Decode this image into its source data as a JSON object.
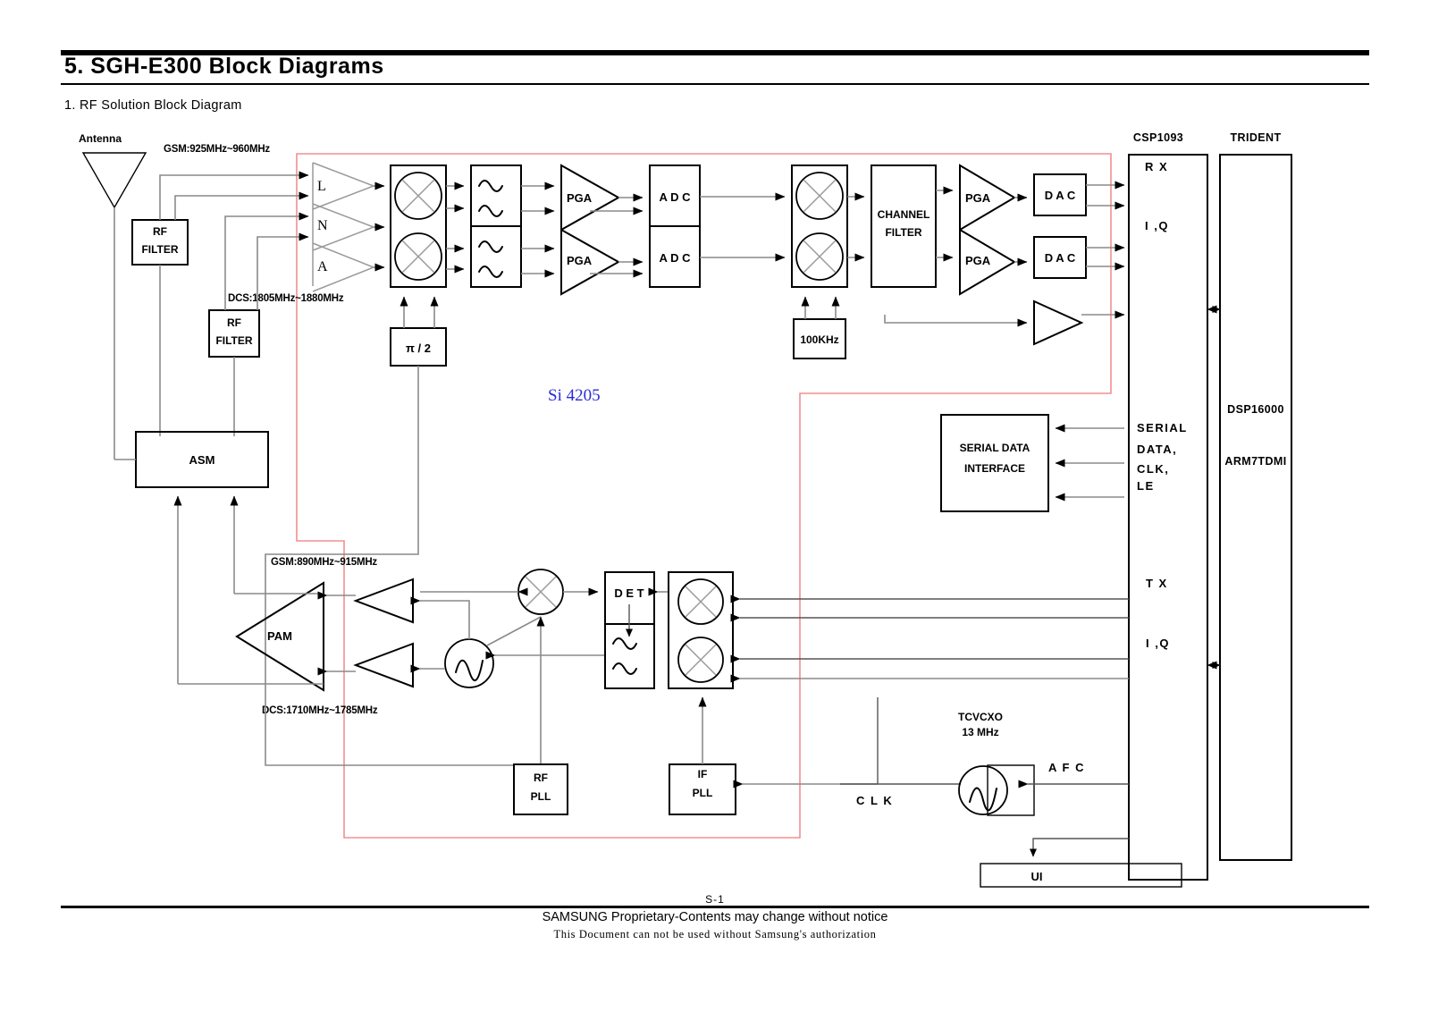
{
  "document": {
    "title": "5. SGH-E300 Block Diagrams",
    "section": "1. RF Solution Block Diagram",
    "page_number": "S-1",
    "footer_line1": "SAMSUNG Proprietary-Contents may change without notice",
    "footer_line2": "This Document can not be used without Samsung's authorization"
  },
  "colors": {
    "chip_boundary": "#f28f8f",
    "si_label": "#2b2bd8",
    "wire": "#8a8a8a",
    "block_stroke": "#000000"
  },
  "diagram": {
    "type": "block-diagram",
    "chip_boundary_label": "Si 4205",
    "annotations": {
      "antenna": "Antenna",
      "gsm_rx_band": "GSM:925MHz~960MHz",
      "dcs_rx_band": "DCS:1805MHz~1880MHz",
      "gsm_tx_band": "GSM:890MHz~915MHz",
      "dcs_tx_band": "DCS:1710MHz~1785MHz",
      "clk": "C L K",
      "afc": "A F C"
    },
    "blocks": [
      {
        "id": "rf-filter-1",
        "label_lines": [
          "RF",
          "FILTER"
        ]
      },
      {
        "id": "rf-filter-2",
        "label_lines": [
          "RF",
          "FILTER"
        ]
      },
      {
        "id": "asm",
        "label_lines": [
          "ASM"
        ]
      },
      {
        "id": "lna",
        "label_lines": [
          "L",
          "N",
          "A"
        ]
      },
      {
        "id": "rx-mixer",
        "label_lines": []
      },
      {
        "id": "phase-shift",
        "label_lines": [
          "π / 2"
        ]
      },
      {
        "id": "rx-lpf",
        "label_lines": []
      },
      {
        "id": "rx-pga-i",
        "label_lines": [
          "PGA"
        ]
      },
      {
        "id": "rx-pga-q",
        "label_lines": [
          "PGA"
        ]
      },
      {
        "id": "adc-i",
        "label_lines": [
          "A D C"
        ]
      },
      {
        "id": "adc-q",
        "label_lines": [
          "A D C"
        ]
      },
      {
        "id": "if-mixer-rx",
        "label_lines": []
      },
      {
        "id": "osc-100khz",
        "label_lines": [
          "100KHz"
        ]
      },
      {
        "id": "channel-filter",
        "label_lines": [
          "CHANNEL",
          "FILTER"
        ]
      },
      {
        "id": "out-pga-i",
        "label_lines": [
          "PGA"
        ]
      },
      {
        "id": "out-pga-q",
        "label_lines": [
          "PGA"
        ]
      },
      {
        "id": "dac-i",
        "label_lines": [
          "D A C"
        ]
      },
      {
        "id": "dac-q",
        "label_lines": [
          "D A C"
        ]
      },
      {
        "id": "aux-amp",
        "label_lines": []
      },
      {
        "id": "serial-data-interface",
        "label_lines": [
          "SERIAL DATA",
          "INTERFACE"
        ]
      },
      {
        "id": "pam",
        "label_lines": [
          "PAM"
        ]
      },
      {
        "id": "drv-amp-gsm",
        "label_lines": []
      },
      {
        "id": "drv-amp-dcs",
        "label_lines": []
      },
      {
        "id": "tx-osc",
        "label_lines": []
      },
      {
        "id": "tx-mixer",
        "label_lines": []
      },
      {
        "id": "det",
        "label_lines": [
          "D E T"
        ]
      },
      {
        "id": "if-modulator",
        "label_lines": []
      },
      {
        "id": "rf-pll",
        "label_lines": [
          "RF",
          "PLL"
        ]
      },
      {
        "id": "if-pll",
        "label_lines": [
          "IF",
          "PLL"
        ]
      },
      {
        "id": "tcvcxo",
        "label_lines": [
          "TCVCXO",
          "13 MHz"
        ]
      },
      {
        "id": "ui",
        "label_lines": [
          "UI"
        ]
      }
    ],
    "chips": {
      "csp1093": {
        "title": "CSP1093",
        "pins": [
          "R  X",
          "I ,Q",
          "SERIAL",
          "DATA,",
          "CLK,",
          "LE",
          "T  X",
          "I ,Q"
        ]
      },
      "trident": {
        "title": "TRIDENT",
        "cores": [
          "DSP16000",
          "ARM7TDMI"
        ]
      }
    }
  }
}
